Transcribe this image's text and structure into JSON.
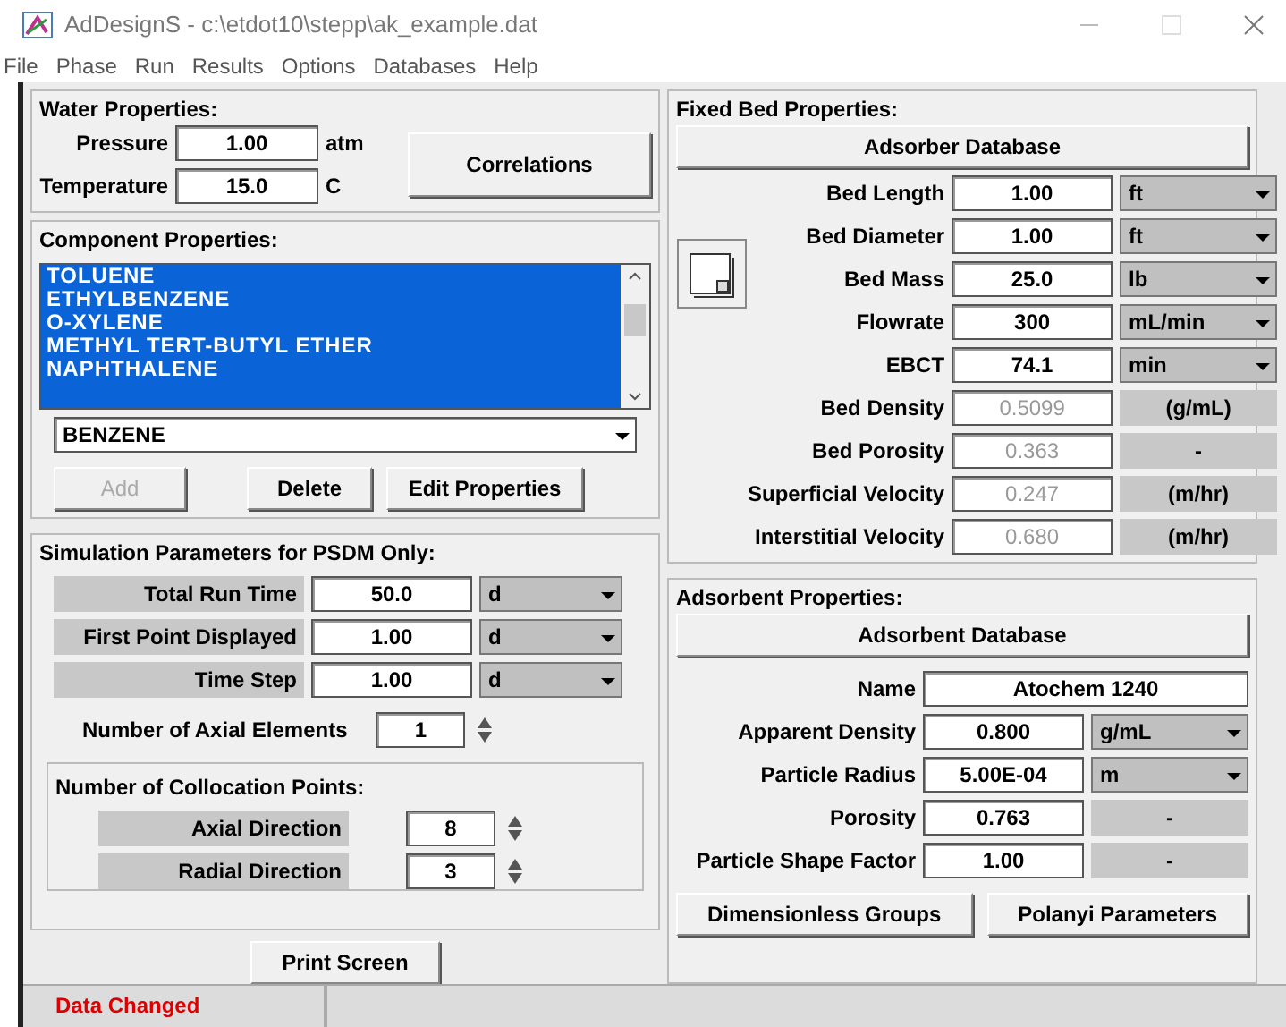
{
  "window": {
    "title": "AdDesignS  -  c:\\etdot10\\stepp\\ak_example.dat"
  },
  "menu": [
    "File",
    "Phase",
    "Run",
    "Results",
    "Options",
    "Databases",
    "Help"
  ],
  "water_properties": {
    "title": "Water Properties:",
    "fields": [
      {
        "label": "Pressure",
        "value": "1.00",
        "unit": "atm"
      },
      {
        "label": "Temperature",
        "value": "15.0",
        "unit": "C"
      }
    ],
    "button": "Correlations"
  },
  "component_properties": {
    "title": "Component Properties:",
    "items": [
      {
        "label": "TOLUENE",
        "selected": true
      },
      {
        "label": "ETHYLBENZENE",
        "selected": true
      },
      {
        "label": "O-XYLENE",
        "selected": true
      },
      {
        "label": "METHYL TERT-BUTYL ETHER",
        "selected": true
      },
      {
        "label": "NAPHTHALENE",
        "selected": true
      }
    ],
    "combo": "BENZENE",
    "buttons": [
      {
        "label": "Add",
        "disabled": true
      },
      {
        "label": "Delete",
        "disabled": false
      },
      {
        "label": "Edit Properties",
        "disabled": false
      }
    ]
  },
  "simulation": {
    "title": "Simulation Parameters for PSDM Only:",
    "time_fields": [
      {
        "label": "Total Run Time",
        "value": "50.0",
        "unit": "d"
      },
      {
        "label": "First Point Displayed",
        "value": "1.00",
        "unit": "d"
      },
      {
        "label": "Time Step",
        "value": "1.00",
        "unit": "d"
      }
    ],
    "axial_elements": {
      "label": "Number of Axial Elements",
      "value": "1"
    },
    "collocation": {
      "title": "Number of Collocation Points:",
      "fields": [
        {
          "label": "Axial Direction",
          "value": "8"
        },
        {
          "label": "Radial Direction",
          "value": "3"
        }
      ]
    }
  },
  "print_button": "Print Screen",
  "fixed_bed": {
    "title": "Fixed Bed Properties:",
    "database_button": "Adsorber Database",
    "rows": [
      {
        "label": "Bed Length",
        "value": "1.00",
        "unit": "ft",
        "kind": "input"
      },
      {
        "label": "Bed Diameter",
        "value": "1.00",
        "unit": "ft",
        "kind": "input"
      },
      {
        "label": "Bed Mass",
        "value": "25.0",
        "unit": "lb",
        "kind": "input"
      },
      {
        "label": "Flowrate",
        "value": "300",
        "unit": "mL/min",
        "kind": "input"
      },
      {
        "label": "EBCT",
        "value": "74.1",
        "unit": "min",
        "kind": "input"
      },
      {
        "label": "Bed Density",
        "value": "0.5099",
        "unit": "(g/mL)",
        "kind": "computed"
      },
      {
        "label": "Bed Porosity",
        "value": "0.363",
        "unit": "-",
        "kind": "computed"
      },
      {
        "label": "Superficial Velocity",
        "value": "0.247",
        "unit": "(m/hr)",
        "kind": "computed"
      },
      {
        "label": "Interstitial Velocity",
        "value": "0.680",
        "unit": "(m/hr)",
        "kind": "computed"
      }
    ]
  },
  "adsorbent": {
    "title": "Adsorbent Properties:",
    "database_button": "Adsorbent Database",
    "name": {
      "label": "Name",
      "value": "Atochem 1240"
    },
    "rows": [
      {
        "label": "Apparent Density",
        "value": "0.800",
        "unit": "g/mL",
        "kind": "input"
      },
      {
        "label": "Particle Radius",
        "value": "5.00E-04",
        "unit": "m",
        "kind": "input"
      },
      {
        "label": "Porosity",
        "value": "0.763",
        "unit": "-",
        "kind": "fixed"
      },
      {
        "label": "Particle Shape Factor",
        "value": "1.00",
        "unit": "-",
        "kind": "fixed"
      }
    ],
    "buttons": [
      "Dimensionless Groups",
      "Polanyi Parameters"
    ]
  },
  "status_bar": {
    "message": "Data Changed"
  }
}
